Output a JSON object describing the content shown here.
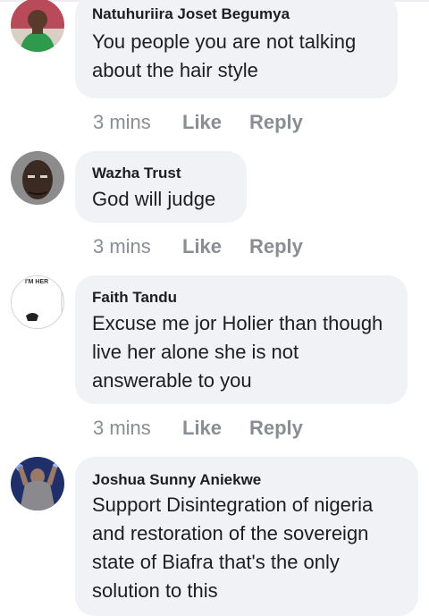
{
  "comments": [
    {
      "author": "Natuhuriira Joset Begumya",
      "text": "You people you are not talking about the hair style",
      "time": "3 mins",
      "like": "Like",
      "reply": "Reply",
      "avatar": "profile-photo-woman-icon"
    },
    {
      "author": "Wazha Trust",
      "text": "God will judge",
      "time": "3 mins",
      "like": "Like",
      "reply": "Reply",
      "avatar": "profile-photo-man-icon"
    },
    {
      "author": "Faith Tandu",
      "text": "Excuse me jor Holier than though live her alone she is not answerable to you",
      "time": "3 mins",
      "like": "Like",
      "reply": "Reply",
      "avatar": "profile-photo-poster-icon",
      "avatar_text": "I'M HER"
    },
    {
      "author": "Joshua Sunny Aniekwe",
      "text": "Support Disintegration of nigeria and restoration of the sovereign state of Biafra that's the only solution to this",
      "avatar": "profile-photo-wrestler-icon"
    }
  ],
  "colors": {
    "bubble": "#f0f2f5",
    "text": "#1c1e21",
    "meta": "#8a8d91"
  }
}
